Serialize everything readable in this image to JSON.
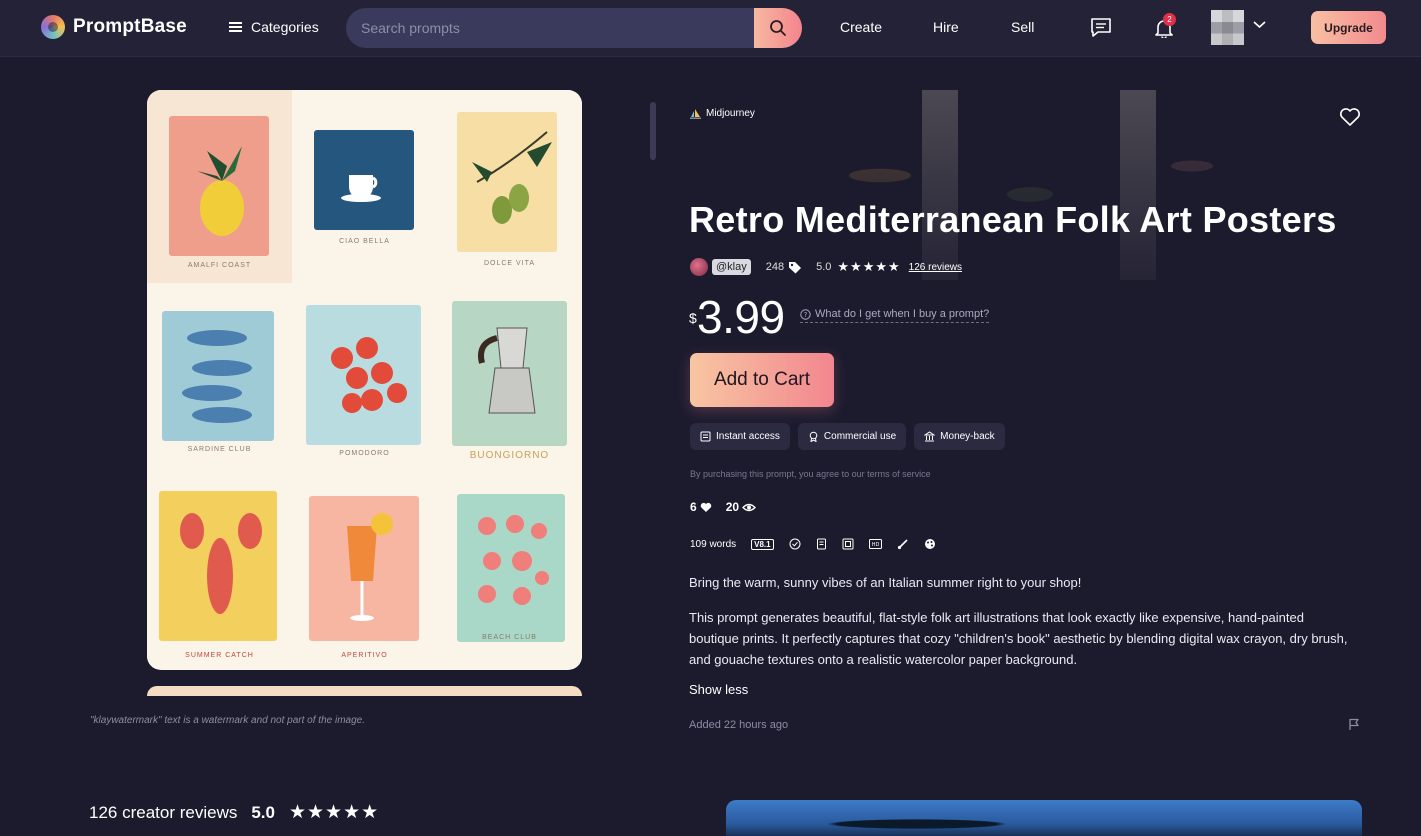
{
  "nav": {
    "brand": "PromptBase",
    "categories_label": "Categories",
    "search_placeholder": "Search prompts",
    "links": [
      "Create",
      "Hire",
      "Sell"
    ],
    "notification_count": "2",
    "upgrade_label": "Upgrade"
  },
  "preview": {
    "captions": [
      "AMALFI COAST",
      "CIAO BELLA",
      "DOLCE VITA",
      "SARDINE CLUB",
      "POMODORO",
      "BUONGIORNO",
      "SUMMER CATCH",
      "APERITIVO",
      "BEACH CLUB"
    ],
    "watermark_note": "\"klaywatermark\" text is a watermark and not part of the image."
  },
  "product": {
    "model": "Midjourney",
    "title": "Retro Mediterranean Folk Art Posters",
    "creator": "@klay",
    "creator_count": "248",
    "rating": "5.0",
    "stars": "★★★★★",
    "reviews_link": "126 reviews",
    "currency": "$",
    "price": "3.99",
    "what_get": "What do I get when I buy a prompt?",
    "cart_label": "Add to Cart",
    "features": [
      "Instant access",
      "Commercial use",
      "Money-back"
    ],
    "terms": "By purchasing this prompt, you agree to our terms of service",
    "likes": "6",
    "views": "20",
    "words": "109 words",
    "version": "V8.1",
    "description": [
      "Bring the warm, sunny vibes of an Italian summer right to your shop!",
      "This prompt generates beautiful, flat-style folk art illustrations that look exactly like expensive, hand-painted boutique prints. It perfectly captures that cozy \"children's book\" aesthetic by blending digital wax crayon, dry brush, and gouache textures onto a realistic watercolor paper background."
    ],
    "show_less": "Show less",
    "added": "Added 22 hours ago"
  },
  "reviews_summary": {
    "label": "126 creator reviews",
    "score": "5.0",
    "stars": "★★★★★"
  },
  "colors": {
    "background": "#1c1b2e",
    "accent_start": "#f8c6a2",
    "accent_end": "#f2868f"
  }
}
